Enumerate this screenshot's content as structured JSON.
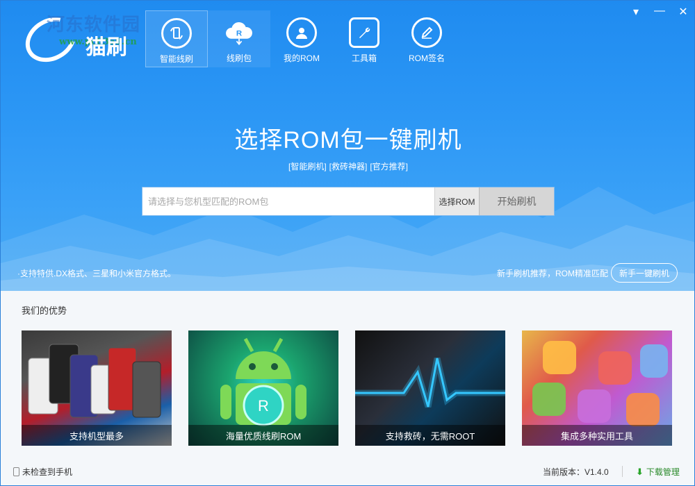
{
  "brand": {
    "logo_text": "猫刷",
    "watermark_line1": "河东软件园",
    "watermark_line2": "www.pc0359.cn"
  },
  "nav": [
    {
      "label": "智能线刷",
      "icon": "phone-refresh-icon"
    },
    {
      "label": "线刷包",
      "icon": "rom-cloud-icon"
    },
    {
      "label": "我的ROM",
      "icon": "user-icon"
    },
    {
      "label": "工具箱",
      "icon": "wrench-icon"
    },
    {
      "label": "ROM签名",
      "icon": "pen-icon"
    }
  ],
  "window_controls": {
    "menu": "▾",
    "minimize": "—",
    "close": "✕"
  },
  "hero": {
    "headline": "选择ROM包一键刷机",
    "sublinks": [
      "[智能刷机]",
      "[救砖神器]",
      "[官方推荐]"
    ],
    "search_placeholder": "请选择与您机型匹配的ROM包",
    "choose_button": "选择ROM",
    "start_button": "开始刷机",
    "support_text": "·支持特供.DX格式、三星和小米官方格式。",
    "recommend_text": "新手刷机推荐，ROM精准匹配",
    "recommend_button": "新手一键刷机"
  },
  "advantages": {
    "title": "我们的优势",
    "cards": [
      {
        "caption": "支持机型最多"
      },
      {
        "caption": "海量优质线刷ROM"
      },
      {
        "caption": "支持救砖，无需ROOT"
      },
      {
        "caption": "集成多种实用工具"
      }
    ]
  },
  "footer": {
    "phone_status": "未检查到手机",
    "version": "当前版本：V1.4.0",
    "download_manage": "下载管理"
  },
  "colors": {
    "accent": "#2c97f5",
    "download": "#2a8a2a"
  }
}
